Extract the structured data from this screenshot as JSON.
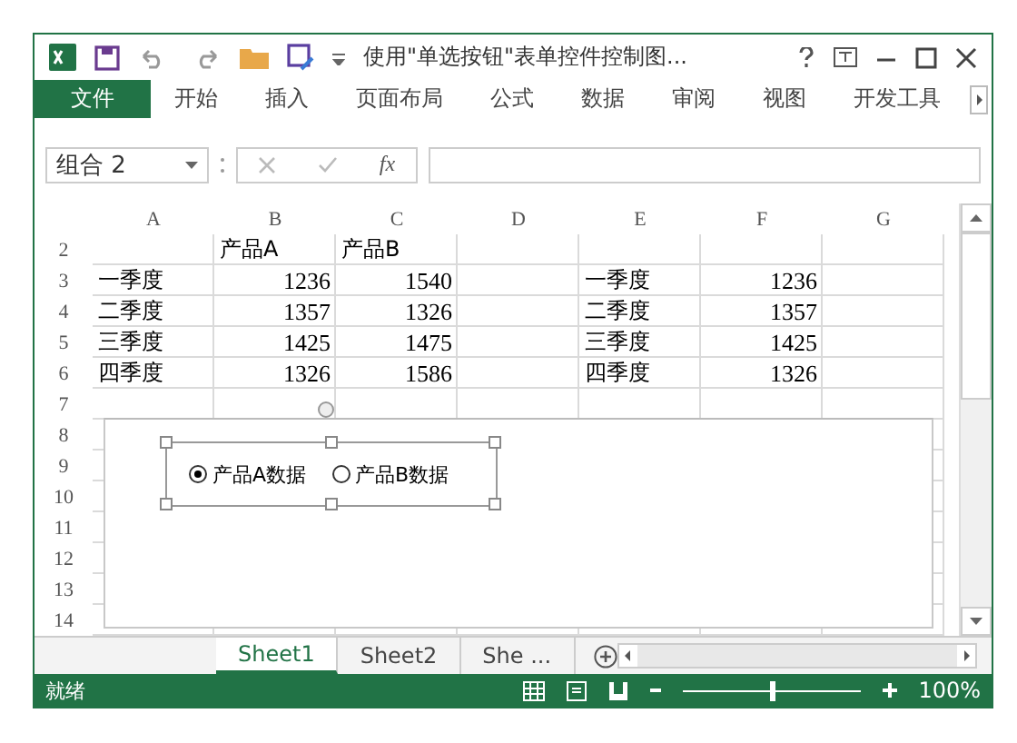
{
  "window": {
    "title": "使用\"单选按钮\"表单控件控制图..."
  },
  "ribbon": {
    "tabs": [
      {
        "label": "文件",
        "kind": "file",
        "selected": false
      },
      {
        "label": "开始",
        "kind": "tab",
        "selected": false
      },
      {
        "label": "插入",
        "kind": "tab",
        "selected": false
      },
      {
        "label": "页面布局",
        "kind": "tab",
        "selected": false
      },
      {
        "label": "公式",
        "kind": "tab",
        "selected": false
      },
      {
        "label": "数据",
        "kind": "tab",
        "selected": false
      },
      {
        "label": "审阅",
        "kind": "tab",
        "selected": false
      },
      {
        "label": "视图",
        "kind": "tab",
        "selected": false
      },
      {
        "label": "开发工具",
        "kind": "tab",
        "selected": false
      }
    ]
  },
  "formula_bar": {
    "name_box": "组合 2",
    "function_label": "fx"
  },
  "sheet": {
    "columns": [
      "A",
      "B",
      "C",
      "D",
      "E",
      "F",
      "G"
    ],
    "rows": [
      {
        "number": "2",
        "cells": [
          "",
          "产品A",
          "产品B",
          "",
          "",
          "",
          ""
        ]
      },
      {
        "number": "3",
        "cells": [
          "一季度",
          "1236",
          "1540",
          "",
          "一季度",
          "1236",
          ""
        ]
      },
      {
        "number": "4",
        "cells": [
          "二季度",
          "1357",
          "1326",
          "",
          "二季度",
          "1357",
          ""
        ]
      },
      {
        "number": "5",
        "cells": [
          "三季度",
          "1425",
          "1475",
          "",
          "三季度",
          "1425",
          ""
        ]
      },
      {
        "number": "6",
        "cells": [
          "四季度",
          "1326",
          "1586",
          "",
          "四季度",
          "1326",
          ""
        ]
      },
      {
        "number": "7",
        "cells": [
          "",
          "",
          "",
          "",
          "",
          "",
          ""
        ]
      },
      {
        "number": "8",
        "cells": [
          "",
          "",
          "",
          "",
          "",
          "",
          ""
        ]
      },
      {
        "number": "9",
        "cells": [
          "",
          "",
          "",
          "",
          "",
          "",
          ""
        ]
      },
      {
        "number": "10",
        "cells": [
          "",
          "",
          "",
          "",
          "",
          "",
          ""
        ]
      },
      {
        "number": "11",
        "cells": [
          "",
          "",
          "",
          "",
          "",
          "",
          ""
        ]
      },
      {
        "number": "12",
        "cells": [
          "",
          "",
          "",
          "",
          "",
          "",
          ""
        ]
      },
      {
        "number": "13",
        "cells": [
          "",
          "",
          "",
          "",
          "",
          "",
          ""
        ]
      },
      {
        "number": "14",
        "cells": [
          "",
          "",
          "",
          "",
          "",
          "",
          ""
        ]
      }
    ]
  },
  "form_control": {
    "options": [
      {
        "label": "产品A数据",
        "selected": true
      },
      {
        "label": "产品B数据",
        "selected": false
      }
    ]
  },
  "sheet_tabs": [
    {
      "label": "Sheet1",
      "selected": true
    },
    {
      "label": "Sheet2",
      "selected": false
    },
    {
      "label": "She ...",
      "selected": false
    }
  ],
  "status_bar": {
    "status": "就绪",
    "zoom": {
      "level": 0.5,
      "reading": "100%"
    }
  }
}
